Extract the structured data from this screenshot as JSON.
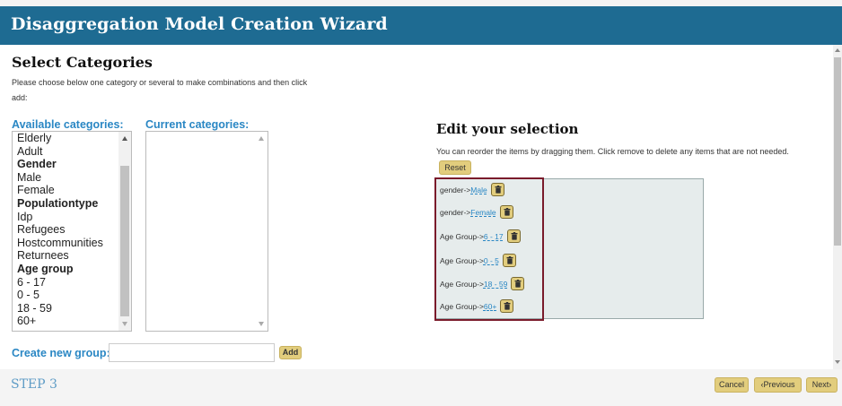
{
  "header": {
    "title": "Disaggregation Model Creation Wizard"
  },
  "select": {
    "title": "Select Categories",
    "instructions": "Please choose below one category or several to make combinations and then click add:",
    "available_label": "Available categories:",
    "current_label": "Current categories:",
    "available_items": [
      {
        "label": "Elderly",
        "group": false
      },
      {
        "label": "Adult",
        "group": false
      },
      {
        "label": "Gender",
        "group": true
      },
      {
        "label": "Male",
        "group": false
      },
      {
        "label": "Female",
        "group": false
      },
      {
        "label": "Populationtype",
        "group": true
      },
      {
        "label": "Idp",
        "group": false
      },
      {
        "label": "Refugees",
        "group": false
      },
      {
        "label": "Hostcommunities",
        "group": false
      },
      {
        "label": "Returnees",
        "group": false
      },
      {
        "label": "Age group",
        "group": true
      },
      {
        "label": "6 - 17",
        "group": false
      },
      {
        "label": "0 - 5",
        "group": false
      },
      {
        "label": "18 - 59",
        "group": false
      },
      {
        "label": "60+",
        "group": false
      }
    ],
    "current_items": []
  },
  "create": {
    "label": "Create new group:",
    "placeholder": "",
    "add_label": "Add"
  },
  "edit": {
    "title": "Edit your selection",
    "instructions": "You can reorder the items by dragging them. Click remove to delete any items that are not needed.",
    "reset_label": "Reset",
    "items": [
      {
        "prefix": "gender->",
        "value": "Male"
      },
      {
        "prefix": "gender->",
        "value": "Female"
      },
      {
        "prefix": "Age Group->",
        "value": "6 - 17"
      },
      {
        "prefix": "Age Group->",
        "value": "0 - 5"
      },
      {
        "prefix": "Age Group->",
        "value": "18 - 59"
      },
      {
        "prefix": "Age Group->",
        "value": "60+"
      }
    ]
  },
  "footer": {
    "step_label": "STEP 3",
    "cancel_label": "Cancel",
    "previous_label": "‹Previous",
    "next_label": "Next›"
  }
}
